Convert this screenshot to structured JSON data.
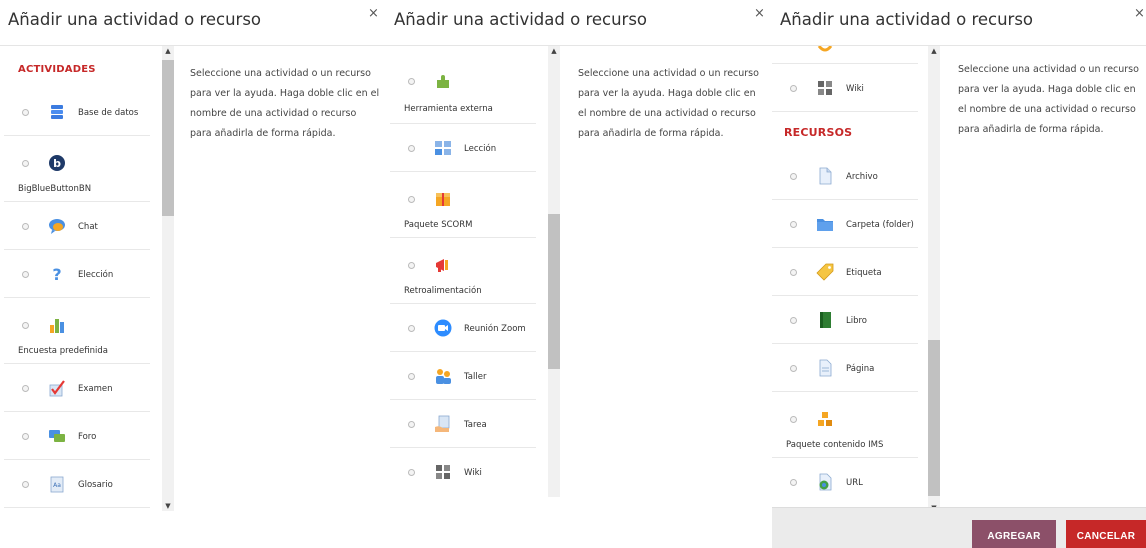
{
  "dialog": {
    "title": "Añadir una actividad o recurso",
    "close_glyph": "×",
    "help_text": "Seleccione una actividad o un recurso para ver la ayuda. Haga doble clic en el nombre de una actividad o recurso para añadirla de forma rápida."
  },
  "panel1": {
    "section": "ACTIVIDADES",
    "items": [
      {
        "label": "Base de datos",
        "icon": "database-icon"
      },
      {
        "label": "BigBlueButtonBN",
        "icon": "bigbluebutton-icon"
      },
      {
        "label": "Chat",
        "icon": "chat-icon"
      },
      {
        "label": "Elección",
        "icon": "choice-icon"
      },
      {
        "label": "Encuesta predefinida",
        "icon": "survey-icon"
      },
      {
        "label": "Examen",
        "icon": "quiz-icon"
      },
      {
        "label": "Foro",
        "icon": "forum-icon"
      },
      {
        "label": "Glosario",
        "icon": "glossary-icon"
      }
    ]
  },
  "panel2": {
    "items": [
      {
        "label": "Herramienta externa",
        "icon": "external-tool-icon"
      },
      {
        "label": "Lección",
        "icon": "lesson-icon"
      },
      {
        "label": "Paquete SCORM",
        "icon": "scorm-icon"
      },
      {
        "label": "Retroalimentación",
        "icon": "feedback-icon"
      },
      {
        "label": "Reunión Zoom",
        "icon": "zoom-icon"
      },
      {
        "label": "Taller",
        "icon": "workshop-icon"
      },
      {
        "label": "Tarea",
        "icon": "assignment-icon"
      },
      {
        "label": "Wiki",
        "icon": "wiki-icon"
      }
    ]
  },
  "panel3": {
    "section": "RECURSOS",
    "items": [
      {
        "label": "Wiki",
        "icon": "wiki-icon"
      },
      {
        "label": "Archivo",
        "icon": "file-icon"
      },
      {
        "label": "Carpeta (folder)",
        "icon": "folder-icon"
      },
      {
        "label": "Etiqueta",
        "icon": "label-icon"
      },
      {
        "label": "Libro",
        "icon": "book-icon"
      },
      {
        "label": "Página",
        "icon": "page-icon"
      },
      {
        "label": "Paquete contenido IMS",
        "icon": "ims-icon"
      },
      {
        "label": "URL",
        "icon": "url-icon"
      }
    ]
  },
  "footer": {
    "add_label": "AGREGAR",
    "cancel_label": "CANCELAR"
  },
  "colors": {
    "accent_red": "#c62828",
    "add_button": "#8c5069"
  }
}
